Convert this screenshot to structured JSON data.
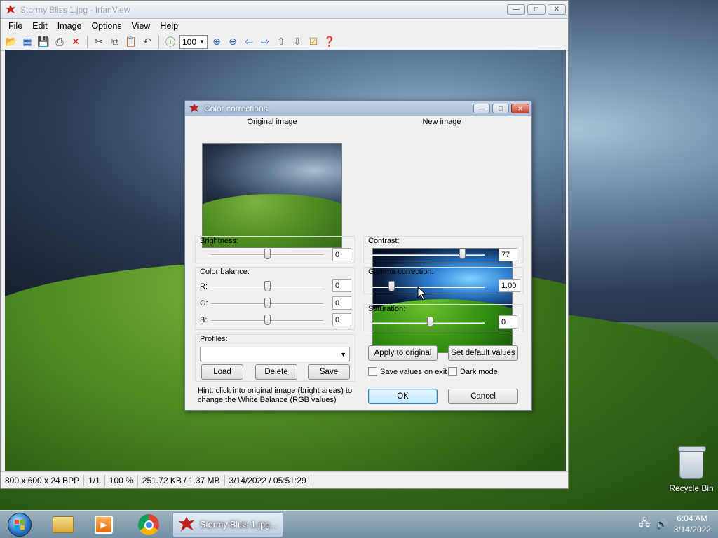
{
  "window": {
    "title": "Stormy Bliss 1.jpg - IrfanView",
    "menu": [
      "File",
      "Edit",
      "Image",
      "Options",
      "View",
      "Help"
    ],
    "zoom": "100",
    "status": [
      "800 x 600 x 24 BPP",
      "1/1",
      "100 %",
      "251.72 KB / 1.37 MB",
      "3/14/2022 / 05:51:29"
    ]
  },
  "dialog": {
    "title": "Color corrections",
    "original_label": "Original image",
    "new_label": "New image",
    "brightness": {
      "label": "Brightness:",
      "value": "0",
      "slider": 0.5
    },
    "contrast": {
      "label": "Contrast:",
      "value": "77",
      "slider": 0.79
    },
    "color_balance": {
      "label": "Color balance:",
      "r": {
        "label": "R:",
        "value": "0"
      },
      "g": {
        "label": "G:",
        "value": "0"
      },
      "b": {
        "label": "B:",
        "value": "0"
      }
    },
    "gamma": {
      "label": "Gamma correction:",
      "value": "1.00",
      "slider": 0.15
    },
    "saturation": {
      "label": "Saturation:",
      "value": "0",
      "slider": 0.5
    },
    "profiles": {
      "label": "Profiles:",
      "selected": ""
    },
    "buttons": {
      "load": "Load",
      "delete": "Delete",
      "save": "Save",
      "apply": "Apply to original",
      "defaults": "Set default values",
      "ok": "OK",
      "cancel": "Cancel"
    },
    "checkboxes": {
      "save_on_exit": "Save values on exit",
      "dark_mode": "Dark mode"
    },
    "hint": "Hint: click into original image (bright areas) to change the White Balance (RGB values)"
  },
  "taskbar": {
    "active_task": "Stormy Bliss 1.jpg...",
    "time": "6:04 AM",
    "date": "3/14/2022"
  },
  "desktop": {
    "recycle_bin": "Recycle Bin"
  }
}
